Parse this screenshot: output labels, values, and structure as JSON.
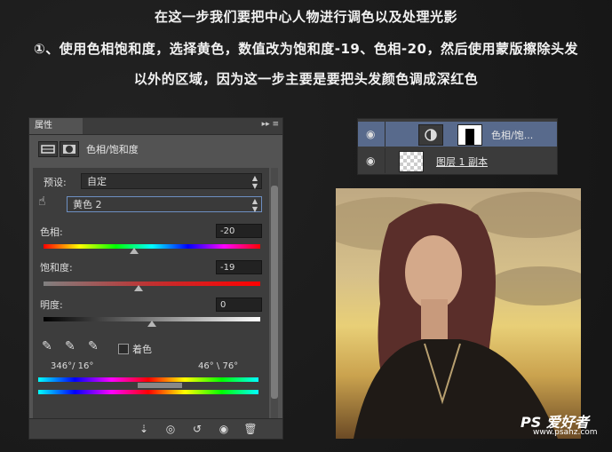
{
  "headlines": {
    "line1": "在这一步我们要把中心人物进行调色以及处理光影",
    "line2": "①、使用色相饱和度，选择黄色，数值改为饱和度-19、色相-20，然后使用蒙版擦除头发",
    "line3": "以外的区域，因为这一步主要是要把头发颜色调成深红色"
  },
  "properties_panel": {
    "tab_label": "属性",
    "menu_glyph": "▸▸ ≡",
    "adjustment_title": "色相/饱和度",
    "preset_label": "预设:",
    "preset_value": "自定",
    "channel_value": "黄色 2",
    "hue_label": "色相:",
    "hue_value": "-20",
    "hue_fraction": 0.42,
    "saturation_label": "饱和度:",
    "saturation_value": "-19",
    "saturation_fraction": 0.44,
    "lightness_label": "明度:",
    "lightness_value": "0",
    "lightness_fraction": 0.5,
    "colorize_label": "着色",
    "range_left": "346°/ 16°",
    "range_right": "46° \\ 76°",
    "bottom_icons": [
      "clip-to-layer-icon",
      "view-previous-icon",
      "reset-icon",
      "visibility-icon",
      "trash-icon"
    ]
  },
  "layers_panel": {
    "layers": [
      {
        "name": "色相/饱...",
        "type": "adjustment",
        "selected": true
      },
      {
        "name": "图层 1 副本",
        "type": "pixel",
        "selected": false
      }
    ]
  },
  "watermark": {
    "logo": "PS 爱好者",
    "url": "www.psahz.com"
  },
  "colors": {
    "panel_bg": "#535353",
    "selection_blue": "#586a8c",
    "active_field_border": "#6d8fc2"
  }
}
